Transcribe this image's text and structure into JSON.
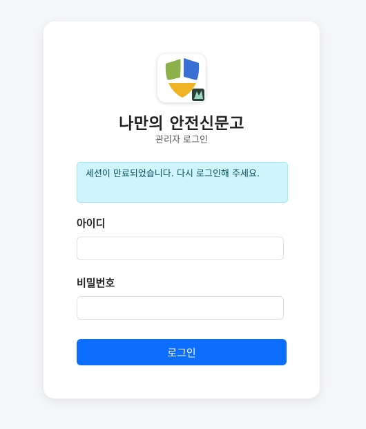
{
  "app": {
    "title": "나만의 안전신문고",
    "subtitle": "관리자 로그인"
  },
  "alert": {
    "message": "세션이 만료되었습니다. 다시 로그인해 주세요."
  },
  "form": {
    "id_label": "아이디",
    "id_value": "",
    "password_label": "비밀번호",
    "password_value": "",
    "submit_label": "로그인"
  },
  "colors": {
    "primary": "#0d6efd",
    "alert_bg": "#cff4fc",
    "shield_green": "#8db04a",
    "shield_blue": "#3a6fd4",
    "shield_yellow": "#f0b323"
  },
  "icons": {
    "logo": "shield-logo-icon"
  }
}
